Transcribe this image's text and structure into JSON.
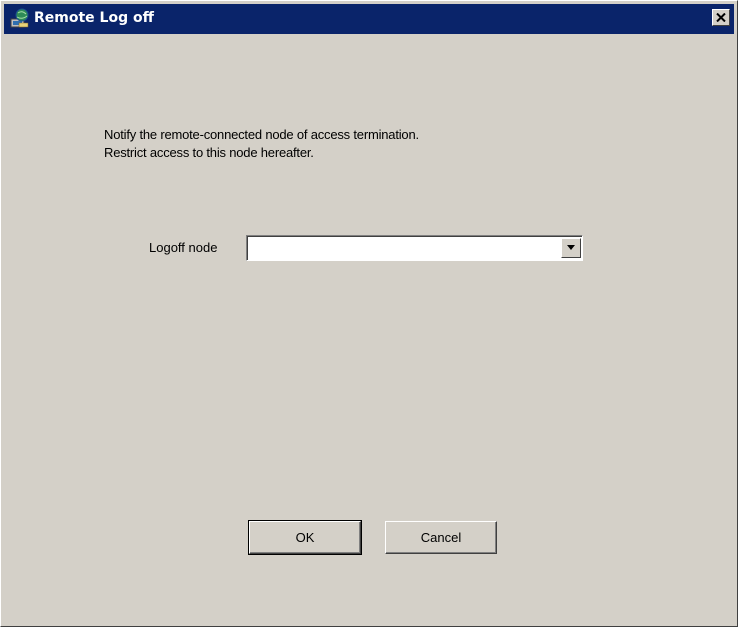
{
  "window": {
    "title": "Remote Log off",
    "title_icon": "network-computer-icon",
    "close_icon": "close-icon"
  },
  "dialog": {
    "message_line1": "Notify the remote-connected node of access termination.",
    "message_line2": "Restrict access to this node hereafter.",
    "logoff_node_label": "Logoff node",
    "logoff_node_value": "",
    "dropdown_icon": "chevron-down-icon"
  },
  "buttons": {
    "ok_label": "OK",
    "cancel_label": "Cancel"
  },
  "colors": {
    "titlebar": "#0a246a",
    "face": "#d4d0c8"
  }
}
